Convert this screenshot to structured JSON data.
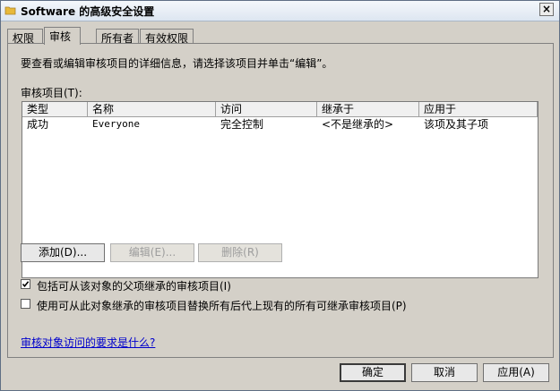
{
  "window": {
    "title": "Software 的高级安全设置",
    "close_glyph": "×"
  },
  "tabs": [
    {
      "label": "权限",
      "active": false
    },
    {
      "label": "审核",
      "active": true
    },
    {
      "label": "所有者",
      "active": false
    },
    {
      "label": "有效权限",
      "active": false
    }
  ],
  "audit": {
    "description": "要查看或编辑审核项目的详细信息，请选择该项目并单击“编辑”。",
    "list_label": "审核项目(T):",
    "columns": [
      "类型",
      "名称",
      "访问",
      "继承于",
      "应用于"
    ],
    "rows": [
      {
        "type": "成功",
        "name": "Everyone",
        "access": "完全控制",
        "inherited_from": "<不是继承的>",
        "applies_to": "该项及其子项"
      }
    ],
    "add_button": "添加(D)...",
    "edit_button": "编辑(E)...",
    "remove_button": "删除(R)",
    "include_inheritable": {
      "label": "包括可从该对象的父项继承的审核项目(I)",
      "checked": true
    },
    "replace_child": {
      "label": "使用可从此对象继承的审核项目替换所有后代上现有的所有可继承审核项目(P)",
      "checked": false
    },
    "help_link": "审核对象访问的要求是什么?"
  },
  "footer": {
    "ok_button": "确定",
    "cancel_button": "取消",
    "apply_button": "应用(A)"
  },
  "colors": {
    "window_bg": "#d4d0c8",
    "link": "#0000cc",
    "folder": "#e8b93a"
  }
}
